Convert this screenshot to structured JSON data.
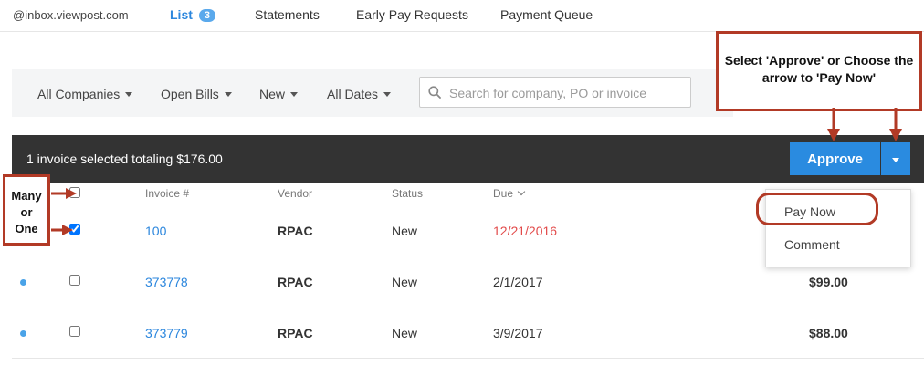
{
  "topnav": {
    "email": "@inbox.viewpost.com",
    "list_label": "List",
    "list_count": "3",
    "statements": "Statements",
    "early_pay": "Early Pay Requests",
    "payment_queue": "Payment Queue"
  },
  "filters": {
    "companies": "All Companies",
    "bills": "Open Bills",
    "status": "New",
    "dates": "All Dates",
    "search_placeholder": "Search for company, PO or invoice"
  },
  "selection": {
    "text": "1 invoice selected totaling $176.00",
    "approve_label": "Approve"
  },
  "table": {
    "headers": {
      "invoice": "Invoice #",
      "vendor": "Vendor",
      "status": "Status",
      "due": "Due"
    },
    "rows": [
      {
        "invoice": "100",
        "vendor": "RPAC",
        "status": "New",
        "due": "12/21/2016",
        "amount": ""
      },
      {
        "invoice": "373778",
        "vendor": "RPAC",
        "status": "New",
        "due": "2/1/2017",
        "amount": "$99.00"
      },
      {
        "invoice": "373779",
        "vendor": "RPAC",
        "status": "New",
        "due": "3/9/2017",
        "amount": "$88.00"
      }
    ]
  },
  "dropdown": {
    "pay_now": "Pay Now",
    "comment": "Comment"
  },
  "annotations": {
    "approve_note": "Select 'Approve' or Choose the arrow to 'Pay Now'",
    "select_note_line1": "Many",
    "select_note_line2": "or",
    "select_note_line3": "One"
  },
  "colors": {
    "accent": "#2a8be0",
    "annotation_red": "#b23a26",
    "overdue": "#e24b4b"
  }
}
